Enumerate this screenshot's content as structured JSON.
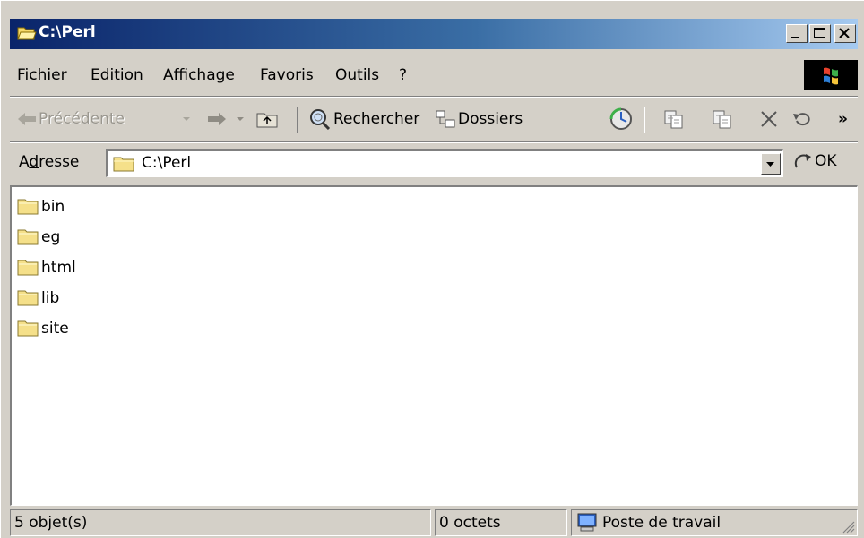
{
  "window": {
    "title": "C:\\Perl",
    "controls": [
      "minimize",
      "maximize",
      "close"
    ]
  },
  "menubar": {
    "items": [
      {
        "label": "Fichier",
        "underline": "F"
      },
      {
        "label": "Edition",
        "underline": "E"
      },
      {
        "label": "Affichage",
        "underline": "h"
      },
      {
        "label": "Favoris",
        "underline": "v"
      },
      {
        "label": "Outils",
        "underline": "O"
      },
      {
        "label": "?",
        "underline": "?"
      }
    ]
  },
  "toolbar": {
    "back_label": "Précédente",
    "search_label": "Rechercher",
    "folders_label": "Dossiers",
    "more_glyph": "»"
  },
  "address": {
    "label": "Adresse",
    "value": "C:\\Perl",
    "go_label": "OK"
  },
  "files": [
    {
      "name": "bin",
      "icon": "folder-icon"
    },
    {
      "name": "eg",
      "icon": "folder-icon"
    },
    {
      "name": "html",
      "icon": "folder-icon"
    },
    {
      "name": "lib",
      "icon": "folder-icon"
    },
    {
      "name": "site",
      "icon": "folder-icon"
    }
  ],
  "status": {
    "count": "5 objet(s)",
    "size": "0 octets",
    "zone": "Poste de travail"
  },
  "colors": {
    "titlebar_start": "#0a246a",
    "titlebar_end": "#a6caf0",
    "face": "#d4d0c8",
    "folder": "#f5e08a"
  }
}
